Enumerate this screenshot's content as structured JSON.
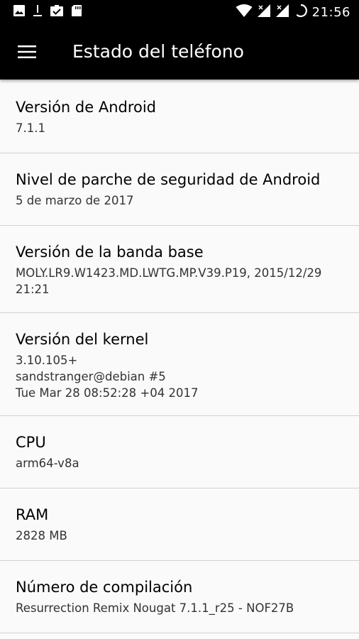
{
  "status_bar": {
    "time": "21:56",
    "left_icons": [
      "image-icon",
      "download-icon",
      "task-icon",
      "sd-card-icon"
    ],
    "right_icons": [
      "wifi-icon",
      "signal-icon",
      "signal-icon",
      "battery-charging-icon"
    ]
  },
  "toolbar": {
    "title": "Estado del teléfono",
    "menu_icon": "hamburger-menu-icon"
  },
  "items": [
    {
      "title": "Versión de Android",
      "summary": "7.1.1"
    },
    {
      "title": "Nivel de parche de seguridad de Android",
      "summary": "5 de marzo de 2017"
    },
    {
      "title": "Versión de la banda base",
      "summary": "MOLY.LR9.W1423.MD.LWTG.MP.V39.P19, 2015/12/29\n21:21"
    },
    {
      "title": "Versión del kernel",
      "summary": "3.10.105+\nsandstranger@debian #5\nTue Mar 28 08:52:28 +04 2017"
    },
    {
      "title": "CPU",
      "summary": "arm64-v8a"
    },
    {
      "title": "RAM",
      "summary": "2828 MB"
    },
    {
      "title": "Número de compilación",
      "summary": "Resurrection Remix Nougat 7.1.1_r25 - NOF27B"
    }
  ],
  "colors": {
    "status_bar": "#000000",
    "toolbar": "#000000",
    "background": "#fafafa",
    "divider": "#d2d2d2"
  }
}
